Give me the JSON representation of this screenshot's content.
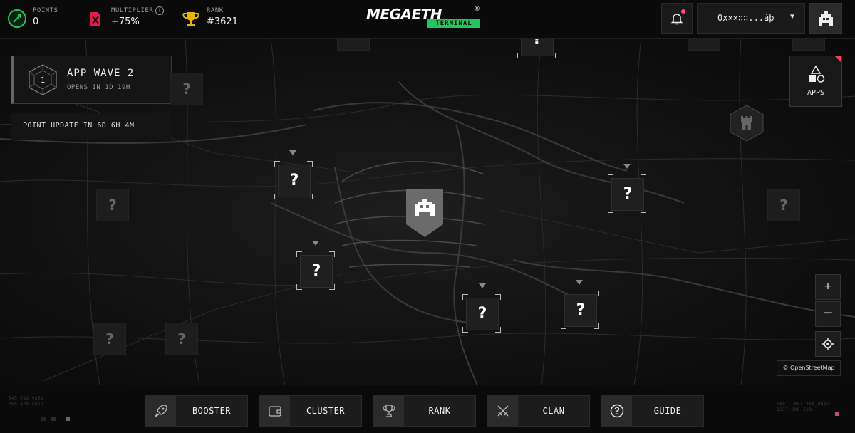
{
  "header": {
    "points": {
      "label": "POINTS",
      "value": "0"
    },
    "multiplier": {
      "label": "MULTIPLIER",
      "value": "+75%"
    },
    "rank": {
      "label": "RANK",
      "value": "#3621"
    },
    "logo": {
      "word": "MEGAETH",
      "sub": "TERMINAL",
      "reg": "®"
    },
    "wallet": {
      "address": "0x××∷∷...ȧþ"
    }
  },
  "panels": {
    "wave": {
      "title": "APP WAVE 2",
      "subtitle": "OPENS IN 1D 19H",
      "badge": "1"
    },
    "point_update": "POINT UPDATE IN 6D 6H 4M",
    "apps": "APPS"
  },
  "map": {
    "mystery_label": "?",
    "attribution": "OpenStreetMap",
    "zoom_in": "+",
    "zoom_out": "−",
    "copyright": "©"
  },
  "nav": [
    {
      "label": "BOOSTER",
      "icon": "rocket-icon"
    },
    {
      "label": "CLUSTER",
      "icon": "wallet-icon"
    },
    {
      "label": "RANK",
      "icon": "trophy-icon"
    },
    {
      "label": "CLAN",
      "icon": "swords-icon"
    },
    {
      "label": "GUIDE",
      "icon": "question-icon"
    }
  ],
  "footer": {
    "left_code_1": "345 742 9852",
    "left_code_2": "096 438 5671",
    "right_code_1": "P487 LB01 384_0847",
    "right_code_2": "3377 098 528"
  },
  "colors": {
    "accent_green": "#22c55e",
    "notification": "#ff4d7d",
    "apps_corner": "#ff3b5c"
  }
}
